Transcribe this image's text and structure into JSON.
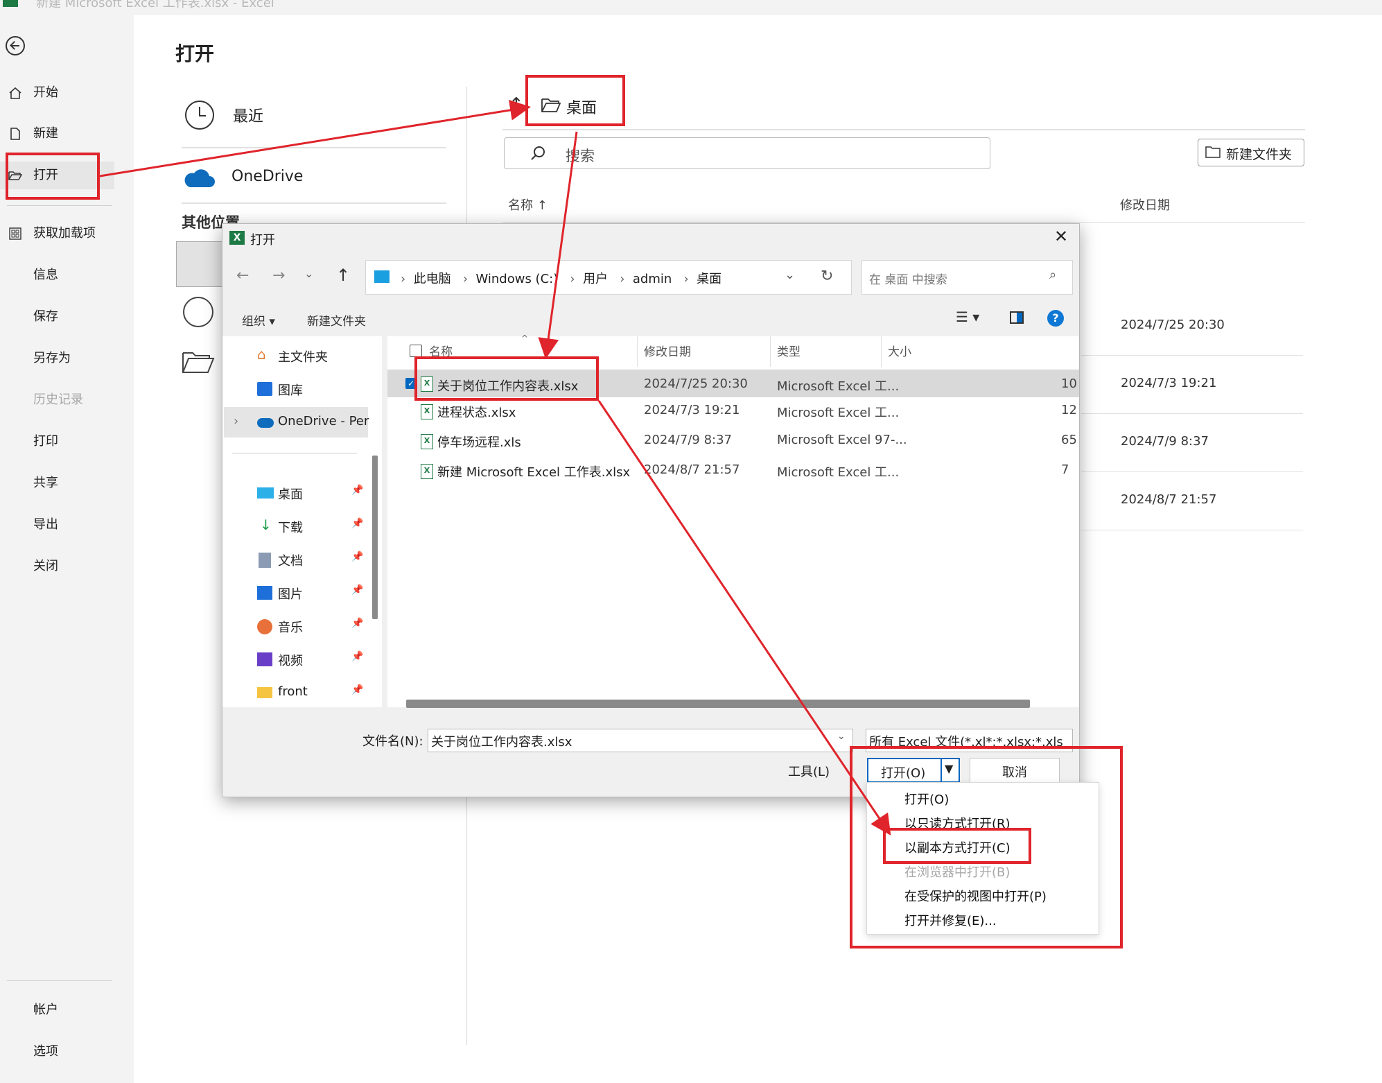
{
  "window": {
    "title": "新建 Microsoft Excel 工作表.xlsx  -  Excel"
  },
  "nav": {
    "items": [
      {
        "label": "开始"
      },
      {
        "label": "新建"
      },
      {
        "label": "打开"
      },
      {
        "label": "获取加载项"
      },
      {
        "label": "信息"
      },
      {
        "label": "保存"
      },
      {
        "label": "另存为"
      },
      {
        "label": "历史记录"
      },
      {
        "label": "打印"
      },
      {
        "label": "共享"
      },
      {
        "label": "导出"
      },
      {
        "label": "关闭"
      }
    ],
    "bottom": [
      {
        "label": "帐户"
      },
      {
        "label": "选项"
      }
    ]
  },
  "backstage": {
    "title": "打开",
    "locations": {
      "recent": "最近",
      "onedrive": "OneDrive",
      "other_heading": "其他位置"
    },
    "folder_title": "桌面",
    "search_placeholder": "搜索",
    "new_folder": "新建文件夹",
    "col_name": "名称",
    "col_modified": "修改日期",
    "dates": [
      "2024/7/25 20:30",
      "2024/7/3 19:21",
      "2024/7/9 8:37",
      "2024/8/7 21:57"
    ]
  },
  "dialog": {
    "title": "打开",
    "breadcrumb": [
      "此电脑",
      "Windows (C:)",
      "用户",
      "admin",
      "桌面"
    ],
    "search_placeholder": "在 桌面 中搜索",
    "toolbar": {
      "organize": "组织",
      "new_folder": "新建文件夹"
    },
    "nav_pane": {
      "top": [
        {
          "label": "主文件夹"
        },
        {
          "label": "图库"
        },
        {
          "label": "OneDrive - Per"
        }
      ],
      "pinned": [
        {
          "label": "桌面"
        },
        {
          "label": "下载"
        },
        {
          "label": "文档"
        },
        {
          "label": "图片"
        },
        {
          "label": "音乐"
        },
        {
          "label": "视频"
        },
        {
          "label": "front"
        }
      ]
    },
    "columns": {
      "name": "名称",
      "modified": "修改日期",
      "type": "类型",
      "size": "大小"
    },
    "files": [
      {
        "name": "关于岗位工作内容表.xlsx",
        "modified": "2024/7/25 20:30",
        "type": "Microsoft Excel 工...",
        "size": "10"
      },
      {
        "name": "进程状态.xlsx",
        "modified": "2024/7/3 19:21",
        "type": "Microsoft Excel 工...",
        "size": "12"
      },
      {
        "name": "停车场远程.xls",
        "modified": "2024/7/9 8:37",
        "type": "Microsoft Excel 97-...",
        "size": "65"
      },
      {
        "name": "新建 Microsoft Excel 工作表.xlsx",
        "modified": "2024/8/7 21:57",
        "type": "Microsoft Excel 工...",
        "size": "7"
      }
    ],
    "filename_label": "文件名(N):",
    "filename_value": "关于岗位工作内容表.xlsx",
    "filetype_value": "所有 Excel 文件(*.xl*;*.xlsx;*.xls",
    "tools": "工具(L)",
    "open_btn": "打开(O)",
    "cancel_btn": "取消",
    "open_menu": [
      {
        "label": "打开(O)"
      },
      {
        "label": "以只读方式打开(R)"
      },
      {
        "label": "以副本方式打开(C)"
      },
      {
        "label": "在浏览器中打开(B)"
      },
      {
        "label": "在受保护的视图中打开(P)"
      },
      {
        "label": "打开并修复(E)..."
      }
    ]
  },
  "colors": {
    "annotation": "#e0242b",
    "accent": "#0067c0",
    "excel_green": "#1d7a44"
  }
}
